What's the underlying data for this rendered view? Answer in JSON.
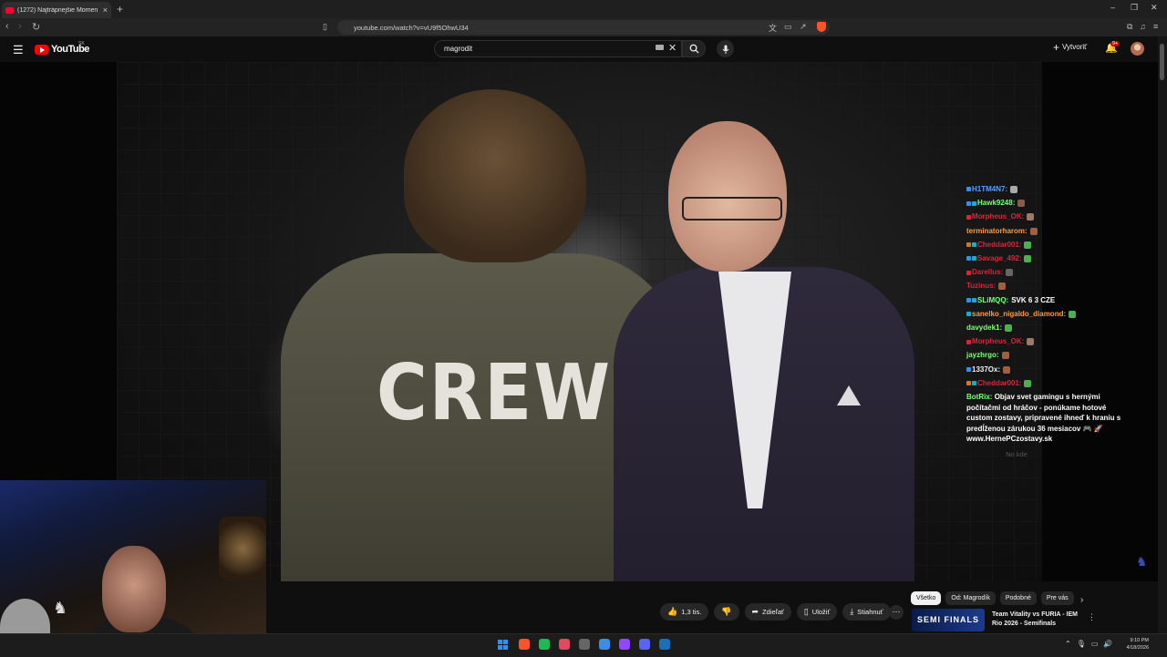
{
  "browser": {
    "tab_title": "(1272) Najtrápnejšie Moment",
    "new_tab_symbol": "+",
    "url": "youtube.com/watch?v=vU9f5OhwU34",
    "window_controls": [
      "–",
      "❐",
      "✕"
    ]
  },
  "youtube": {
    "logo_text": "YouTube",
    "country_code": "SK",
    "search_value": "magrodit",
    "create_label": "Vytvoriť",
    "notifications_badge": "9+",
    "colors": {
      "brand": "#ff0000",
      "background": "#0f0f0f"
    }
  },
  "video": {
    "jacket_text": "CREW"
  },
  "chat": {
    "messages": [
      {
        "user": "H1TM4N7:",
        "color": "#5aa0ff",
        "badges": [
          "#3a8ee6"
        ],
        "emote": "#aaaaaa"
      },
      {
        "user": "Hawk9248:",
        "color": "#7cff7c",
        "badges": [
          "#3a8ee6",
          "#1fa8c9"
        ],
        "emote": "#8a5a4a"
      },
      {
        "user": "Morpheus_OK:",
        "color": "#d6263c",
        "badges": [
          "#d6263c"
        ],
        "emote": "#9a7a6a"
      },
      {
        "user": "terminatorharom:",
        "color": "#ff9a3c",
        "badges": [],
        "emote": "#a06040"
      },
      {
        "user": "Cheddar001:",
        "color": "#d6263c",
        "badges": [
          "#c97a2a",
          "#1fa8c9"
        ],
        "emote": "#4caf50"
      },
      {
        "user": "Savage_492:",
        "color": "#d6263c",
        "badges": [
          "#3a8ee6",
          "#1fa8c9"
        ],
        "emote": "#4caf50"
      },
      {
        "user": "Darellus:",
        "color": "#d6263c",
        "badges": [
          "#d6263c"
        ],
        "emote": "#666666"
      },
      {
        "user": "Tuzinus:",
        "color": "#d6263c",
        "badges": [],
        "emote": "#a06040"
      },
      {
        "user": "SLiMQQ:",
        "color": "#7cff7c",
        "badges": [
          "#3a8ee6",
          "#1fa8c9"
        ],
        "text": "SVK 6 3 CZE"
      },
      {
        "user": "sanelko_nigaldo_diamond:",
        "color": "#ff9a3c",
        "badges": [
          "#1fa8c9"
        ],
        "emote": "#4caf50"
      },
      {
        "user": "davydek1:",
        "color": "#7cff7c",
        "badges": [],
        "emote": "#4caf50"
      },
      {
        "user": "Morpheus_OK:",
        "color": "#d6263c",
        "badges": [
          "#d6263c"
        ],
        "emote": "#9a7a6a"
      },
      {
        "user": "jayzhrgo:",
        "color": "#7cff7c",
        "badges": [],
        "emote": "#a06040"
      },
      {
        "user": "1337Ox:",
        "color": "#f1f1f1",
        "badges": [
          "#3a8ee6"
        ],
        "emote": "#a06040"
      },
      {
        "user": "Cheddar001:",
        "color": "#d6263c",
        "badges": [
          "#c97a2a",
          "#1fa8c9"
        ],
        "emote": "#4caf50"
      }
    ],
    "bot": {
      "user": "BotRix:",
      "color": "#7cff7c",
      "text": "Objav svet gamingu s hernými počítačmi od hráčov - ponúkame hotové custom zostavy, pripravené ihneď k hraniu s predĺženou zárukou 36 mesiacov 🎮 🚀 www.HernePCzostavy.sk"
    },
    "footer": "No kde"
  },
  "actions": {
    "like_count": "1,3 tis.",
    "share": "Zdieľať",
    "save": "Uložiť",
    "download": "Stiahnuť",
    "more": "⋯"
  },
  "chips": {
    "items": [
      "Všetko",
      "Od: Magrodík",
      "Podobné",
      "Pre vás"
    ],
    "active_index": 0
  },
  "recommendation": {
    "thumb_text": "SEMI FINALS",
    "title": "Team Vitality vs FURIA - IEM Rio 2026 - Semifinals"
  },
  "taskbar": {
    "time": "9:10 PM",
    "date": "4/18/2026",
    "apps": [
      "brave",
      "spotify-like",
      "maps",
      "terminal",
      "browser",
      "twitch",
      "discord",
      "steam"
    ],
    "app_colors": [
      "#fb542b",
      "#1db954",
      "#e04a5f",
      "#666666",
      "#3a8ee6",
      "#9146ff",
      "#5865f2",
      "#1b6fb8"
    ]
  }
}
